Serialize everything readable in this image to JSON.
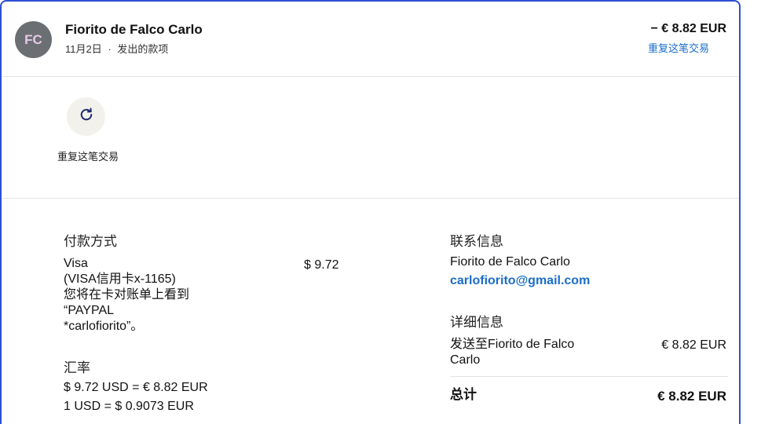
{
  "header": {
    "avatar_initials": "FC",
    "name": "Fiorito de Falco Carlo",
    "date": "11月2日",
    "separator": "·",
    "type": "发出的款项",
    "amount": "− € 8.82 EUR",
    "repeat_link": "重复这笔交易"
  },
  "actions": {
    "repeat_icon": "refresh-icon",
    "repeat_label": "重复这笔交易"
  },
  "payment": {
    "title": "付款方式",
    "method": "Visa",
    "card": "(VISA信用卡x-1165)",
    "statement_line1": "您将在卡对账单上看到",
    "statement_line2": "“PAYPAL",
    "statement_line3": "*carlofiorito”。",
    "amount": "$ 9.72"
  },
  "exchange": {
    "title": "汇率",
    "line1": "$ 9.72 USD = € 8.82 EUR",
    "line2": "1 USD = $ 0.9073 EUR"
  },
  "contact": {
    "title": "联系信息",
    "name": "Fiorito de Falco Carlo",
    "email": "carlofiorito@gmail.com"
  },
  "details": {
    "title": "详细信息",
    "sent_to_line1": "发送至Fiorito de Falco",
    "sent_to_line2": "Carlo",
    "sent_amount": "€ 8.82 EUR",
    "total_label": "总计",
    "total_amount": "€ 8.82 EUR"
  },
  "colors": {
    "border": "#2d4fd6",
    "link": "#1a6dc9",
    "avatar_bg": "#6b6f73",
    "action_bg": "#f2f1ec"
  }
}
